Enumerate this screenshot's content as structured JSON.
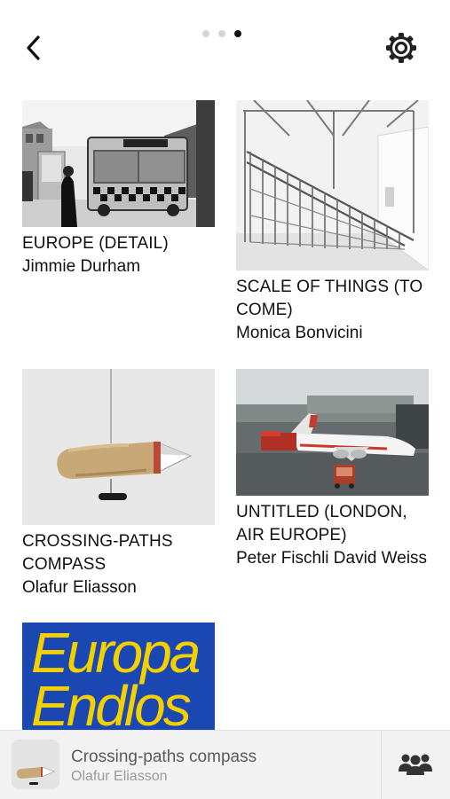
{
  "header": {
    "back_icon": "chevron-left-icon",
    "settings_icon": "gear-icon",
    "page_dots": {
      "count": 3,
      "active_index": 2
    }
  },
  "artworks": [
    {
      "title": "EUROPE (DETAIL)",
      "artist": "Jimmie Durham"
    },
    {
      "title": "SCALE OF THINGS (TO COME)",
      "artist": "Monica Bonvicini"
    },
    {
      "title": "CROSSING-PATHS COMPASS",
      "artist": "Olafur Eliasson"
    },
    {
      "title": "UNTITLED (LONDON, AIR EUROPE)",
      "artist": "Peter Fischli David Weiss"
    },
    {
      "cover_text": "Europa Endlos"
    }
  ],
  "now_playing": {
    "title": "Crossing-paths compass",
    "artist": "Olafur Eliasson",
    "group_icon": "group-icon"
  },
  "colors": {
    "accent_blue": "#1b47b3",
    "cover_yellow": "#f4d000",
    "active_dot": "#111111",
    "inactive_dot": "#d5d5d5",
    "player_bg": "#f2f2f2"
  }
}
